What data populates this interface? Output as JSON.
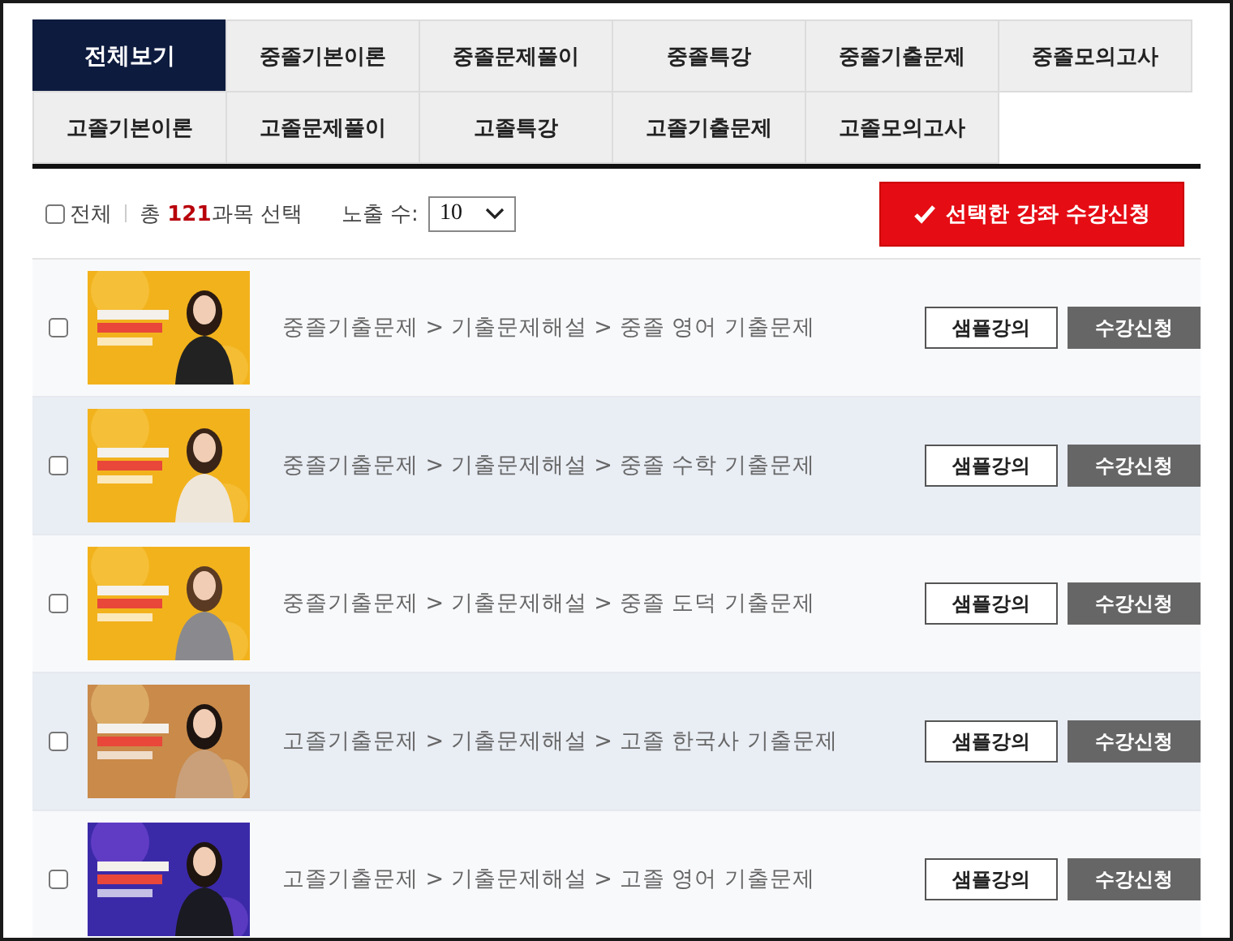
{
  "tabs": [
    [
      {
        "label": "전체보기",
        "selected": true
      },
      {
        "label": "중졸기본이론",
        "selected": false
      },
      {
        "label": "중졸문제풀이",
        "selected": false
      },
      {
        "label": "중졸특강",
        "selected": false
      },
      {
        "label": "중졸기출문제",
        "selected": false
      },
      {
        "label": "중졸모의고사",
        "selected": false
      }
    ],
    [
      {
        "label": "고졸기본이론",
        "selected": false
      },
      {
        "label": "고졸문제풀이",
        "selected": false
      },
      {
        "label": "고졸특강",
        "selected": false
      },
      {
        "label": "고졸기출문제",
        "selected": false
      },
      {
        "label": "고졸모의고사",
        "selected": false
      }
    ]
  ],
  "toolbar": {
    "select_all": {
      "label": "전체",
      "checked": false
    },
    "count_text": "총 **121**과목 선택",
    "per_page": {
      "label": "노출 수:",
      "value": "10"
    },
    "apply_button": "선택한 강좌 수강신청"
  },
  "courses": [
    {
      "checked": false,
      "path": "중졸기출문제 > 기출문제해설 > 중졸 영어 기출문제",
      "sample_button": "샘플강의",
      "enroll_button": "수강신청"
    },
    {
      "checked": false,
      "path": "중졸기출문제 > 기출문제해설 > 중졸 수학 기출문제",
      "sample_button": "샘플강의",
      "enroll_button": "수강신청"
    },
    {
      "checked": false,
      "path": "중졸기출문제 > 기출문제해설 > 중졸 도덕 기출문제",
      "sample_button": "샘플강의",
      "enroll_button": "수강신청"
    },
    {
      "checked": false,
      "path": "고졸기출문제 > 기출문제해설 > 고졸 한국사 기출문제",
      "sample_button": "샘플강의",
      "enroll_button": "수강신청"
    },
    {
      "checked": false,
      "path": "고졸기출문제 > 기출문제해설 > 고졸 영어 기출문제",
      "sample_button": "샘플강의",
      "enroll_button": "수강신청"
    }
  ]
}
